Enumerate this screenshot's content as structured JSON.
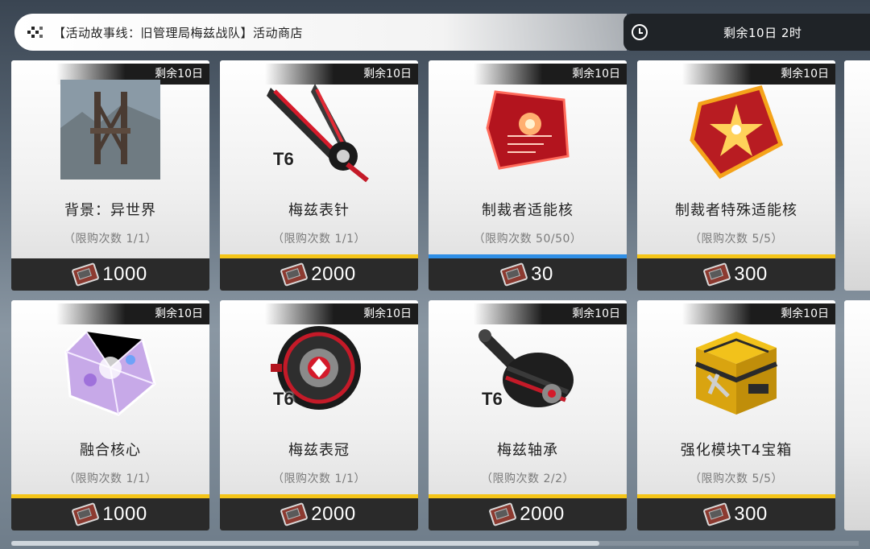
{
  "header": {
    "title": "【活动故事线：旧管理局梅兹战队】活动商店",
    "timer_text": "剩余10日  2时"
  },
  "icons": {
    "menu": "dots-icon",
    "timer": "clock-icon",
    "currency": "ticket-icon"
  },
  "colors": {
    "stripe_yellow": "#f5c518",
    "stripe_blue": "#2f8fe6"
  },
  "items": [
    {
      "badge": "剩余10日",
      "name": "背景：异世界",
      "limit": "（限购次数  1/1）",
      "price": "1000",
      "stripe": "none",
      "art": "background-icon"
    },
    {
      "badge": "剩余10日",
      "name": "梅兹表针",
      "limit": "（限购次数  1/1）",
      "price": "2000",
      "stripe": "yellow",
      "art": "clock-hand-icon",
      "tier": "T6"
    },
    {
      "badge": "剩余10日",
      "name": "制裁者适能核",
      "limit": "（限购次数  50/50）",
      "price": "30",
      "stripe": "blue",
      "art": "core-icon"
    },
    {
      "badge": "剩余10日",
      "name": "制裁者特殊适能核",
      "limit": "（限购次数  5/5）",
      "price": "300",
      "stripe": "yellow",
      "art": "special-core-icon"
    },
    {
      "badge": "剩余10日",
      "name": "融合核心",
      "limit": "（限购次数  1/1）",
      "price": "1000",
      "stripe": "yellow",
      "art": "fusion-core-icon"
    },
    {
      "badge": "剩余10日",
      "name": "梅兹表冠",
      "limit": "（限购次数  1/1）",
      "price": "2000",
      "stripe": "yellow",
      "art": "crown-icon",
      "tier": "T6"
    },
    {
      "badge": "剩余10日",
      "name": "梅兹轴承",
      "limit": "（限购次数  2/2）",
      "price": "2000",
      "stripe": "yellow",
      "art": "bearing-icon",
      "tier": "T6"
    },
    {
      "badge": "剩余10日",
      "name": "强化模块T4宝箱",
      "limit": "（限购次数  5/5）",
      "price": "300",
      "stripe": "yellow",
      "art": "module-box-icon"
    }
  ]
}
